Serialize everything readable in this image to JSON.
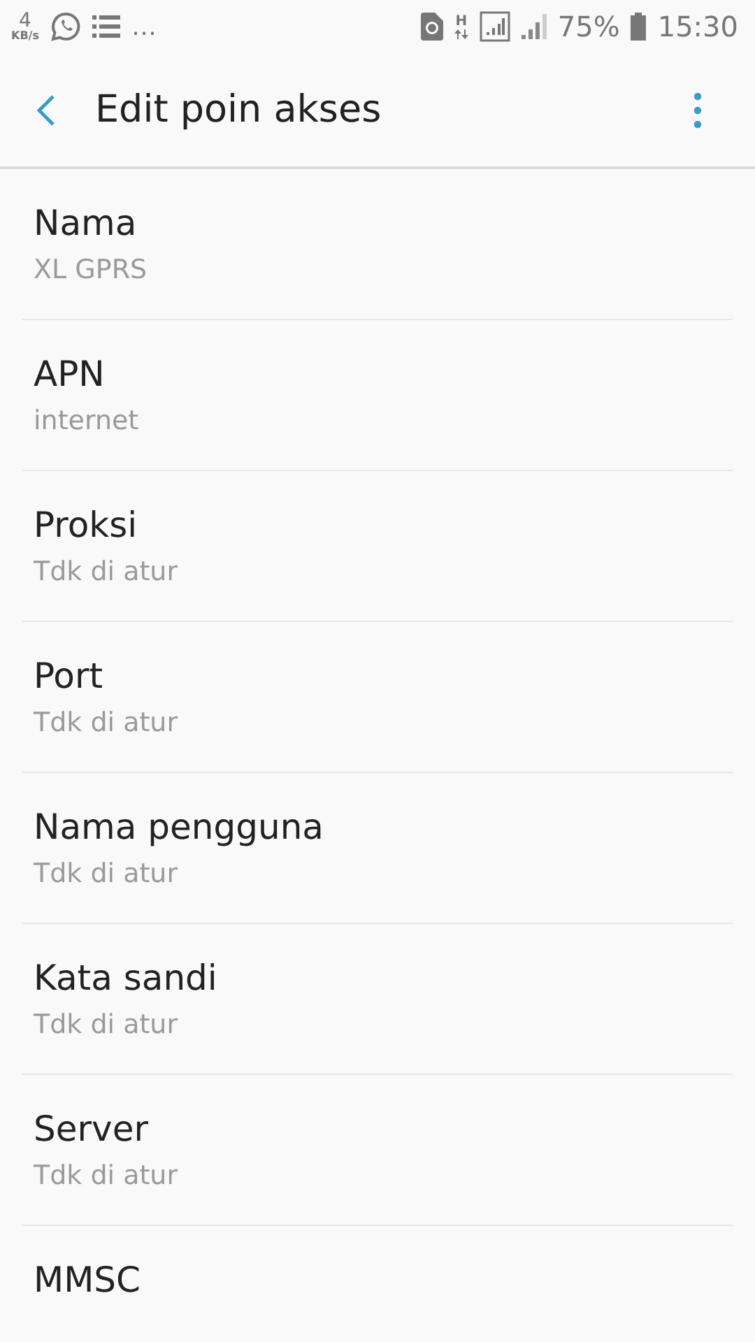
{
  "status_bar": {
    "speed_value": "4",
    "speed_unit": "KB/s",
    "more": "…",
    "network_type": "H",
    "battery_percent": "75%",
    "time": "15:30"
  },
  "app_bar": {
    "title": "Edit poin akses"
  },
  "settings": [
    {
      "title": "Nama",
      "value": "XL GPRS"
    },
    {
      "title": "APN",
      "value": "internet"
    },
    {
      "title": "Proksi",
      "value": "Tdk di atur"
    },
    {
      "title": "Port",
      "value": "Tdk di atur"
    },
    {
      "title": "Nama pengguna",
      "value": "Tdk di atur"
    },
    {
      "title": "Kata sandi",
      "value": "Tdk di atur"
    },
    {
      "title": "Server",
      "value": "Tdk di atur"
    },
    {
      "title": "MMSC"
    }
  ]
}
